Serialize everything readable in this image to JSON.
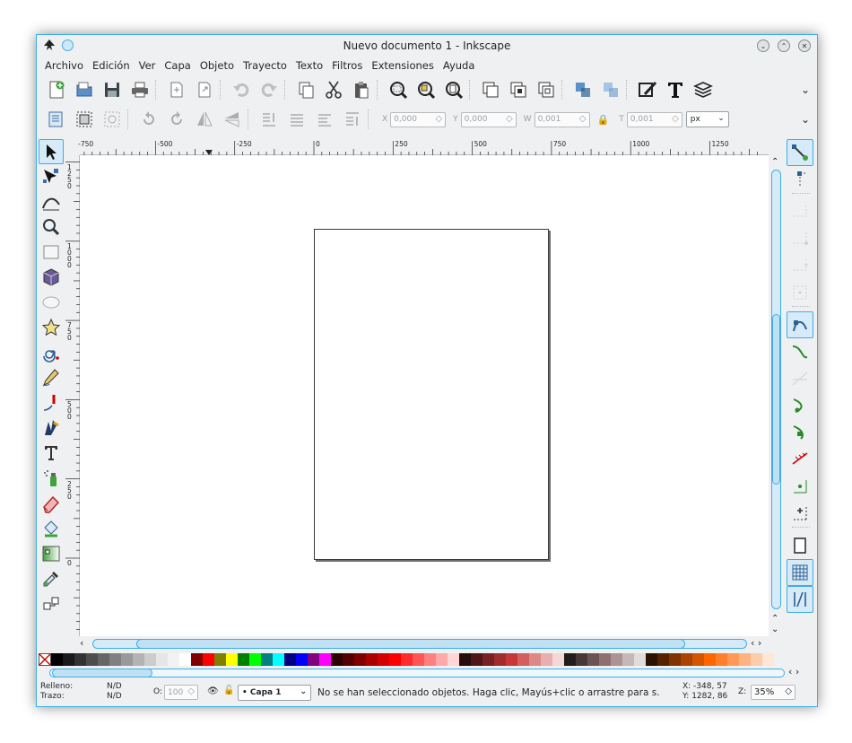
{
  "window": {
    "title": "Nuevo documento 1 - Inkscape"
  },
  "menu": [
    "Archivo",
    "Edición",
    "Ver",
    "Capa",
    "Objeto",
    "Trayecto",
    "Texto",
    "Filtros",
    "Extensiones",
    "Ayuda"
  ],
  "command_bar": [
    "new-document-icon",
    "open-icon",
    "save-icon",
    "print-icon",
    "sep",
    "import-icon",
    "export-icon",
    "sep",
    "undo-icon",
    "redo-icon",
    "sep",
    "copy-icon",
    "cut-icon",
    "paste-icon",
    "sep",
    "zoom-selection-icon",
    "zoom-drawing-icon",
    "zoom-page-icon",
    "sep",
    "duplicate-icon",
    "clone-icon",
    "unlink-clone-icon",
    "sep",
    "group-icon",
    "ungroup-icon",
    "sep",
    "fill-stroke-icon",
    "text-font-icon",
    "layers-icon"
  ],
  "controls": {
    "x_label": "X",
    "x_value": "0,000",
    "y_label": "Y",
    "y_value": "0,000",
    "w_label": "W",
    "w_value": "0,001",
    "h_label": "T",
    "h_value": "0,001",
    "unit": "px"
  },
  "ruler": {
    "h_labels": [
      "-750",
      "-500",
      "-250",
      "0",
      "250",
      "500",
      "750",
      "1000",
      "1250"
    ],
    "v_labels": [
      "1\n2\n5\n0",
      "1\n0\n0\n0",
      "7\n5\n0",
      "5\n0\n0",
      "2\n5\n0",
      "0"
    ]
  },
  "tools": [
    "selector-icon",
    "node-icon",
    "tweak-icon",
    "zoom-icon",
    "rectangle-icon",
    "box-3d-icon",
    "ellipse-icon",
    "star-icon",
    "spiral-icon",
    "pencil-icon",
    "pen-icon",
    "calligraphy-icon",
    "text-icon",
    "spray-icon",
    "eraser-icon",
    "paint-bucket-icon",
    "gradient-icon",
    "dropper-icon",
    "connector-icon"
  ],
  "snap_tools": [
    "snap-toggle-icon",
    "snap-bbox-icon",
    "sep",
    "snap-bbox-edge-icon",
    "snap-bbox-corner-icon",
    "snap-bbox-midpoint-icon",
    "snap-bbox-center-icon",
    "sep",
    "snap-nodes-icon",
    "snap-path-icon",
    "snap-intersection-icon",
    "snap-cusp-icon",
    "snap-smooth-icon",
    "snap-midpoint-icon",
    "snap-center-icon",
    "snap-rotation-icon",
    "sep",
    "snap-page-icon",
    "snap-grid-icon",
    "snap-guide-icon"
  ],
  "palette": {
    "colors": [
      "#000000",
      "#1a1a1a",
      "#333333",
      "#4d4d4d",
      "#666666",
      "#808080",
      "#999999",
      "#b3b3b3",
      "#cccccc",
      "#e6e6e6",
      "#f2f2f2",
      "#ffffff",
      "#800000",
      "#ff0000",
      "#808000",
      "#ffff00",
      "#008000",
      "#00ff00",
      "#008080",
      "#00ffff",
      "#000080",
      "#0000ff",
      "#800080",
      "#ff00ff",
      "#2b0000",
      "#550000",
      "#800000",
      "#aa0000",
      "#d40000",
      "#ff0000",
      "#ff2a2a",
      "#ff5555",
      "#ff8080",
      "#ffaaaa",
      "#ffd5d5",
      "#280b0b",
      "#501616",
      "#782121",
      "#a02c2c",
      "#c83737",
      "#d35f5f",
      "#de8787",
      "#e9afaf",
      "#f4d7d7",
      "#241c1c",
      "#483737",
      "#6c5353",
      "#916f6f",
      "#ac9393",
      "#c8b7b7",
      "#e3dbdb",
      "#2b1100",
      "#552200",
      "#803300",
      "#aa4400",
      "#d45500",
      "#ff6600",
      "#ff7f2a",
      "#ff9955",
      "#ffb380",
      "#ffccaa",
      "#ffe6d5"
    ]
  },
  "status": {
    "fill_label": "Relleno:",
    "stroke_label": "Trazo:",
    "fill_value": "N/D",
    "stroke_value": "N/D",
    "opacity_label": "O:",
    "opacity_value": "100",
    "layer": "• Capa 1",
    "message": "No se han seleccionado objetos. Haga clic, Mayús+clic o arrastre para s.",
    "x_coord": "X: -348, 57",
    "y_coord": "Y: 1282, 86",
    "zoom_label": "Z:",
    "zoom_value": "35%"
  }
}
